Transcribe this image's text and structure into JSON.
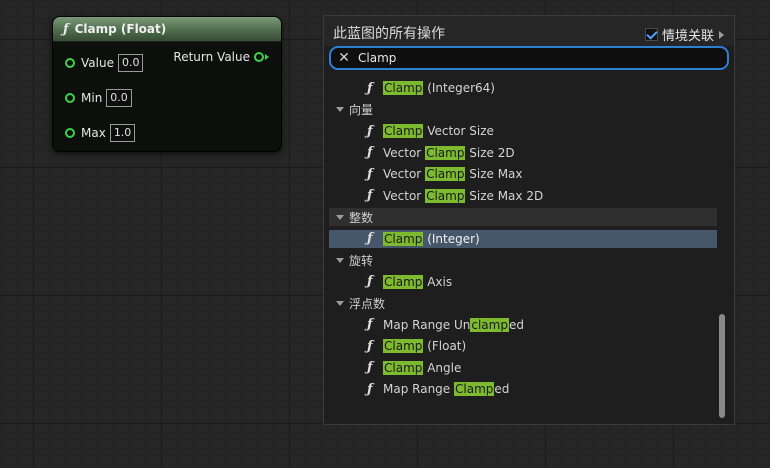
{
  "node": {
    "title": "Clamp (Float)",
    "return_label": "Return Value",
    "inputs": [
      {
        "label": "Value",
        "value": "0.0"
      },
      {
        "label": "Min",
        "value": "0.0"
      },
      {
        "label": "Max",
        "value": "1.0"
      }
    ]
  },
  "palette": {
    "title": "此蓝图的所有操作",
    "context_label": "情境关联",
    "context_checked": true,
    "search_value": "Clamp",
    "rows": [
      {
        "kind": "item",
        "parts": [
          [
            "Clamp",
            true
          ],
          [
            " (Integer64)",
            false
          ]
        ]
      },
      {
        "kind": "cat",
        "label": "向量"
      },
      {
        "kind": "item",
        "parts": [
          [
            "Clamp",
            true
          ],
          [
            " Vector Size",
            false
          ]
        ]
      },
      {
        "kind": "item",
        "parts": [
          [
            "Vector ",
            false
          ],
          [
            "Clamp",
            true
          ],
          [
            " Size 2D",
            false
          ]
        ]
      },
      {
        "kind": "item",
        "parts": [
          [
            "Vector ",
            false
          ],
          [
            "Clamp",
            true
          ],
          [
            " Size Max",
            false
          ]
        ]
      },
      {
        "kind": "item",
        "parts": [
          [
            "Vector ",
            false
          ],
          [
            "Clamp",
            true
          ],
          [
            " Size Max 2D",
            false
          ]
        ]
      },
      {
        "kind": "cat",
        "label": "整数",
        "selected_parent": true
      },
      {
        "kind": "item",
        "selected": true,
        "parts": [
          [
            "Clamp",
            true
          ],
          [
            " (Integer)",
            false
          ]
        ]
      },
      {
        "kind": "cat",
        "label": "旋转"
      },
      {
        "kind": "item",
        "parts": [
          [
            "Clamp",
            true
          ],
          [
            " Axis",
            false
          ]
        ]
      },
      {
        "kind": "cat",
        "label": "浮点数"
      },
      {
        "kind": "item",
        "parts": [
          [
            "Map Range Un",
            false
          ],
          [
            "clamp",
            true
          ],
          [
            "ed",
            false
          ]
        ]
      },
      {
        "kind": "item",
        "parts": [
          [
            "Clamp",
            true
          ],
          [
            " (Float)",
            false
          ]
        ]
      },
      {
        "kind": "item",
        "parts": [
          [
            "Clamp",
            true
          ],
          [
            " Angle",
            false
          ]
        ]
      },
      {
        "kind": "item",
        "parts": [
          [
            "Map Range ",
            false
          ],
          [
            "Clamp",
            true
          ],
          [
            "ed",
            false
          ]
        ]
      }
    ]
  },
  "icons": {
    "function": "ƒ",
    "close": "✕"
  },
  "colors": {
    "accent": "#2d7fd5",
    "highlight": "#7dba30",
    "pin": "#3ad34a",
    "selection": "#46566b"
  }
}
